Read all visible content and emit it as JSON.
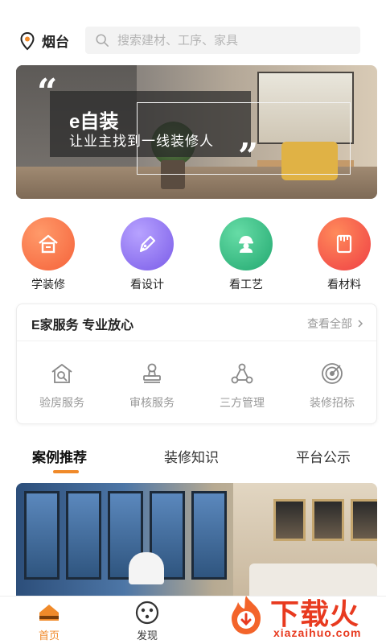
{
  "header": {
    "location": "烟台",
    "search_placeholder": "搜索建材、工序、家具"
  },
  "banner": {
    "title": "e自装",
    "subtitle": "让业主找到一线装修人"
  },
  "categories": [
    {
      "label": "学装修",
      "icon": "house-icon",
      "color": "#f5623a"
    },
    {
      "label": "看设计",
      "icon": "pen-icon",
      "color": "#8a6cf0"
    },
    {
      "label": "看工艺",
      "icon": "worker-icon",
      "color": "#2fbf84"
    },
    {
      "label": "看材料",
      "icon": "material-icon",
      "color": "#f3513e"
    }
  ],
  "service": {
    "title": "E家服务 专业放心",
    "more_label": "查看全部",
    "items": [
      {
        "label": "验房服务",
        "icon": "house-inspect-icon"
      },
      {
        "label": "审核服务",
        "icon": "stamp-icon"
      },
      {
        "label": "三方管理",
        "icon": "network-icon"
      },
      {
        "label": "装修招标",
        "icon": "target-icon"
      }
    ]
  },
  "tabs": [
    {
      "label": "案例推荐",
      "active": true
    },
    {
      "label": "装修知识",
      "active": false
    },
    {
      "label": "平台公示",
      "active": false
    }
  ],
  "bottom_nav": [
    {
      "label": "首页",
      "icon": "home-icon",
      "active": true
    },
    {
      "label": "发现",
      "icon": "discover-icon",
      "active": false
    }
  ],
  "watermark": {
    "text": "下载火",
    "sub": "xiazaihuo.com"
  },
  "colors": {
    "accent": "#f08a2a",
    "watermark": "#e83a1f"
  }
}
